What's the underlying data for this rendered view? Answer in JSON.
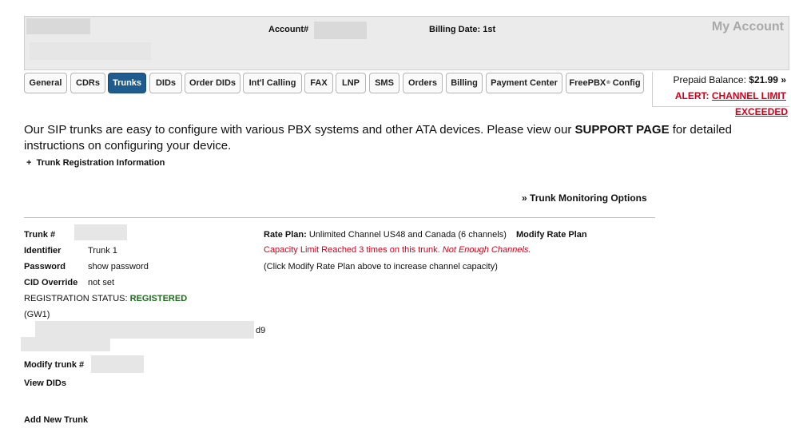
{
  "header": {
    "account_label": "Account#",
    "billing_label": "Billing Date:",
    "billing_value": "1st",
    "my_account": "My Account"
  },
  "tabs": [
    {
      "label": "General",
      "active": false
    },
    {
      "label": "CDRs",
      "active": false
    },
    {
      "label": "Trunks",
      "active": true
    },
    {
      "label": "DIDs",
      "active": false
    },
    {
      "label": "Order DIDs",
      "active": false
    },
    {
      "label": "Int'l Calling",
      "active": false
    },
    {
      "label": "FAX",
      "active": false
    },
    {
      "label": "LNP",
      "active": false
    },
    {
      "label": "SMS",
      "active": false
    },
    {
      "label": "Orders",
      "active": false
    },
    {
      "label": "Billing",
      "active": false
    },
    {
      "label": "Payment Center",
      "active": false
    },
    {
      "label": "FreePBX",
      "sup": "®",
      "suffix": " Config",
      "active": false
    }
  ],
  "balance": {
    "label": "Prepaid Balance:",
    "amount": "$21.99",
    "arrow": "»",
    "alert_prefix": "ALERT:",
    "alert_link_line1": "CHANNEL LIMIT",
    "alert_link_line2": "EXCEEDED"
  },
  "intro": {
    "before": "Our SIP trunks are easy to configure with various PBX systems and other ATA devices. Please view our ",
    "support_link": "SUPPORT PAGE",
    "after": " for detailed instructions on configuring your device."
  },
  "registration_toggle": {
    "symbol": "+",
    "label": "Trunk Registration Information"
  },
  "monitoring": {
    "arrow": "»",
    "label": "Trunk Monitoring Options"
  },
  "trunk": {
    "trunk_label": "Trunk #",
    "identifier_label": "Identifier",
    "identifier_value": "Trunk 1",
    "password_label": "Password",
    "password_value": "show password",
    "cid_label": "CID Override",
    "cid_value": "not set",
    "status_label": "REGISTRATION STATUS:",
    "status_value": "REGISTERED",
    "gateway": "(GW1)",
    "address_suffix": "d9",
    "modify_trunk_label": "Modify trunk #",
    "view_dids": "View DIDs",
    "add_new_trunk": "Add New Trunk"
  },
  "rate_plan": {
    "label": "Rate Plan:",
    "value": "Unlimited Channel US48 and Canada (6 channels)",
    "modify_link": "Modify Rate Plan",
    "capacity_warning": "Capacity Limit Reached 3 times on this trunk. ",
    "capacity_warning_em": "Not Enough Channels.",
    "hint": "(Click Modify Rate Plan above to increase channel capacity)"
  },
  "colors": {
    "active_tab": "#1e5b8f",
    "alert_red": "#d0021b",
    "registered_green": "#1e6b1e",
    "header_bg": "#ebebeb"
  }
}
